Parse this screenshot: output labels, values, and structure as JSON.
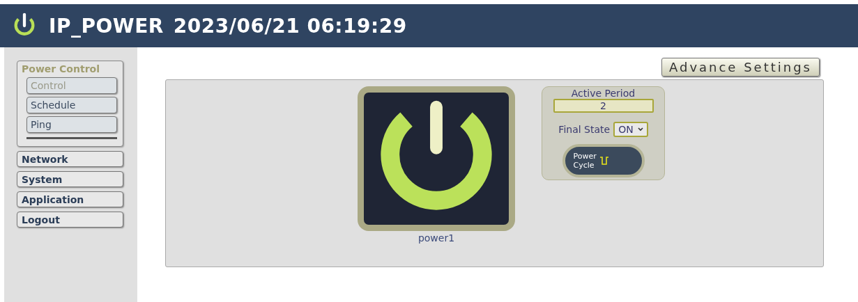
{
  "header": {
    "title": "IP_POWER",
    "datetime": "2023/06/21 06:19:29"
  },
  "sidebar": {
    "group": {
      "label": "Power Control",
      "items": [
        {
          "label": "Control",
          "selected": true
        },
        {
          "label": "Schedule",
          "selected": false
        },
        {
          "label": "Ping",
          "selected": false
        }
      ]
    },
    "items": [
      {
        "label": "Network"
      },
      {
        "label": "System"
      },
      {
        "label": "Application"
      },
      {
        "label": "Logout"
      }
    ]
  },
  "advance_button": "Advance Settings",
  "outlets": [
    {
      "name": "power1",
      "on": true,
      "active_period_label": "Active Period",
      "active_period": "2",
      "final_state_label": "Final State",
      "final_state": "ON",
      "cycle_button": [
        "Power",
        "Cycle"
      ]
    }
  ]
}
